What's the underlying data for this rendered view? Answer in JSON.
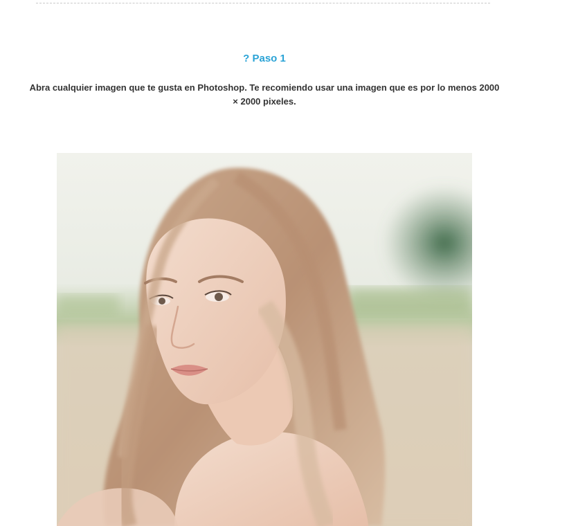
{
  "step": {
    "heading": "? Paso 1",
    "text_line1": "Abra cualquier imagen que te gusta en Photoshop. Te recomiendo usar una imagen que es por lo menos 2000",
    "text_line2": "× 2000 pixeles."
  },
  "image": {
    "alt": "Retrato de una mujer joven con cabello largo rubio"
  },
  "colors": {
    "heading": "#2aa3d6",
    "body_text": "#333333",
    "divider": "#c8c8c8"
  }
}
